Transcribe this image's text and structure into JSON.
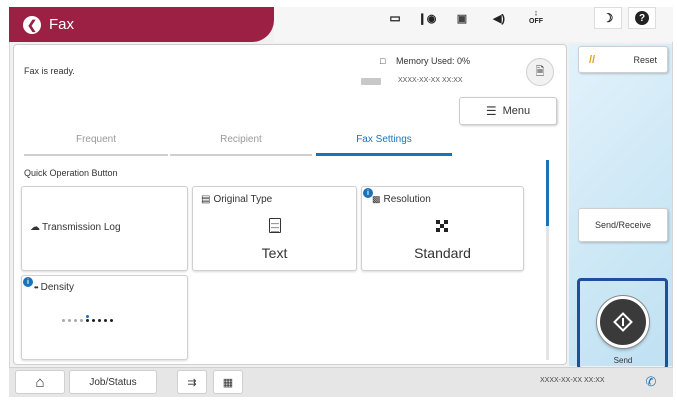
{
  "header": {
    "title": "Fax"
  },
  "status": {
    "fax_ready": "Fax is ready.",
    "memory_used": "Memory Used: 0%",
    "fax_number": "XXXX-XX-XX XX:XX"
  },
  "menu": {
    "label": "Menu"
  },
  "tabs": [
    {
      "label": "Frequent",
      "active": false
    },
    {
      "label": "Recipient",
      "active": false
    },
    {
      "label": "Fax Settings",
      "active": true
    }
  ],
  "section": {
    "label": "Quick Operation Button"
  },
  "cards": {
    "transmission_log": {
      "label": "Transmission Log"
    },
    "original_type": {
      "label": "Original Type",
      "value": "Text"
    },
    "resolution": {
      "label": "Resolution",
      "value": "Standard"
    },
    "density": {
      "label": "Density"
    }
  },
  "side": {
    "reset_label": "Reset",
    "send_receive_label": "Send/Receive",
    "send_label": "Send"
  },
  "bottom": {
    "job_status_label": "Job/Status",
    "fax_number": "XXXX-XX-XX XX:XX"
  },
  "colors": {
    "header_accent": "#9c1f44",
    "active_tab": "#1a73b8",
    "highlight_border": "#1c4f9c"
  }
}
